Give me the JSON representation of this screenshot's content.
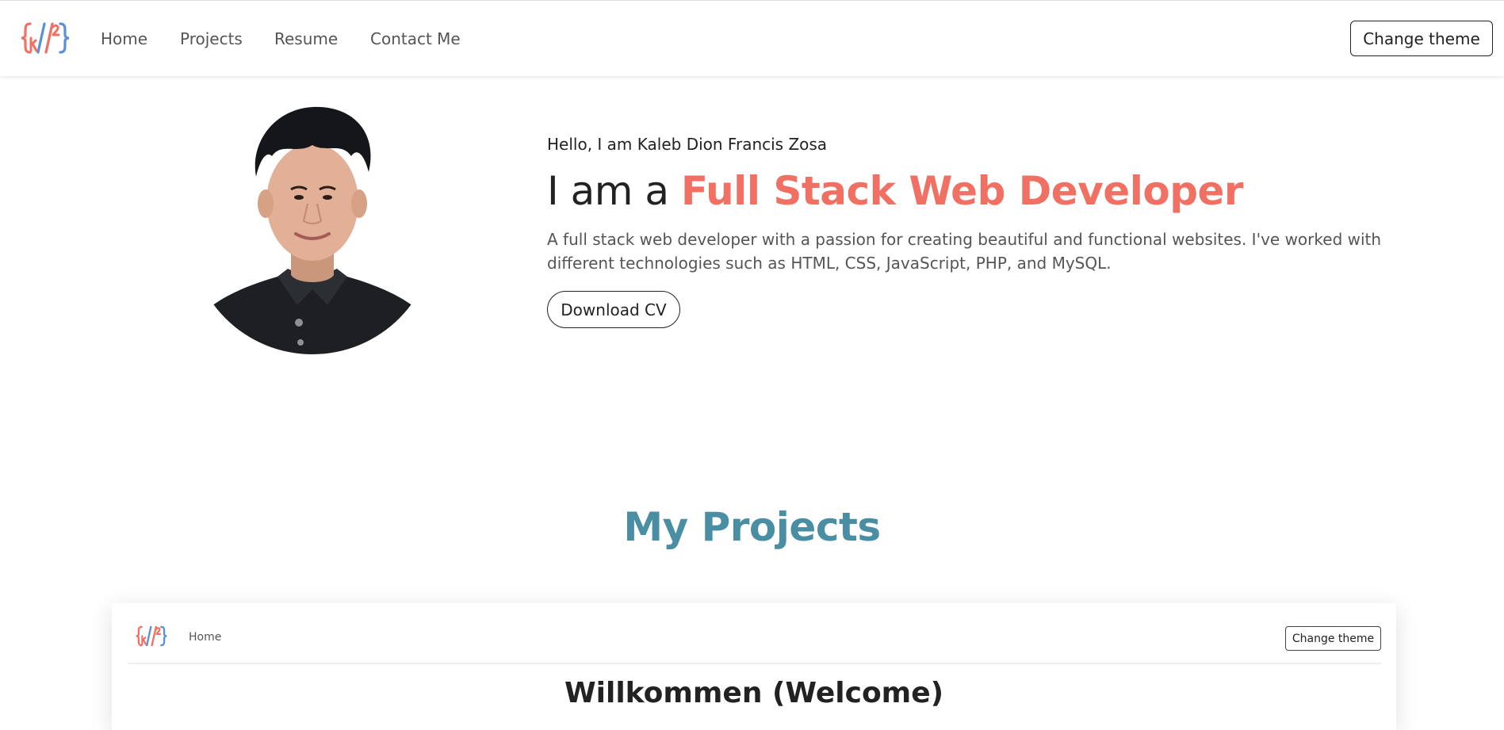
{
  "nav": {
    "links": [
      "Home",
      "Projects",
      "Resume",
      "Contact Me"
    ],
    "theme_button": "Change theme"
  },
  "hero": {
    "greeting": "Hello, I am Kaleb Dion Francis Zosa",
    "headline_prefix": "I am a ",
    "headline_accent": "Full Stack Web Developer",
    "bio": "A full stack web developer with a passion for creating beautiful and functional websites. I've worked with different technologies such as HTML, CSS, JavaScript, PHP, and MySQL.",
    "cv_button": "Download CV"
  },
  "projects": {
    "title": "My Projects",
    "preview": {
      "nav_link": "Home",
      "theme_button": "Change theme",
      "heading": "Willkommen (Welcome)"
    }
  },
  "colors": {
    "accent": "#f07163",
    "section_title": "#4a8ea3",
    "logo_blue": "#5b8fd6"
  }
}
